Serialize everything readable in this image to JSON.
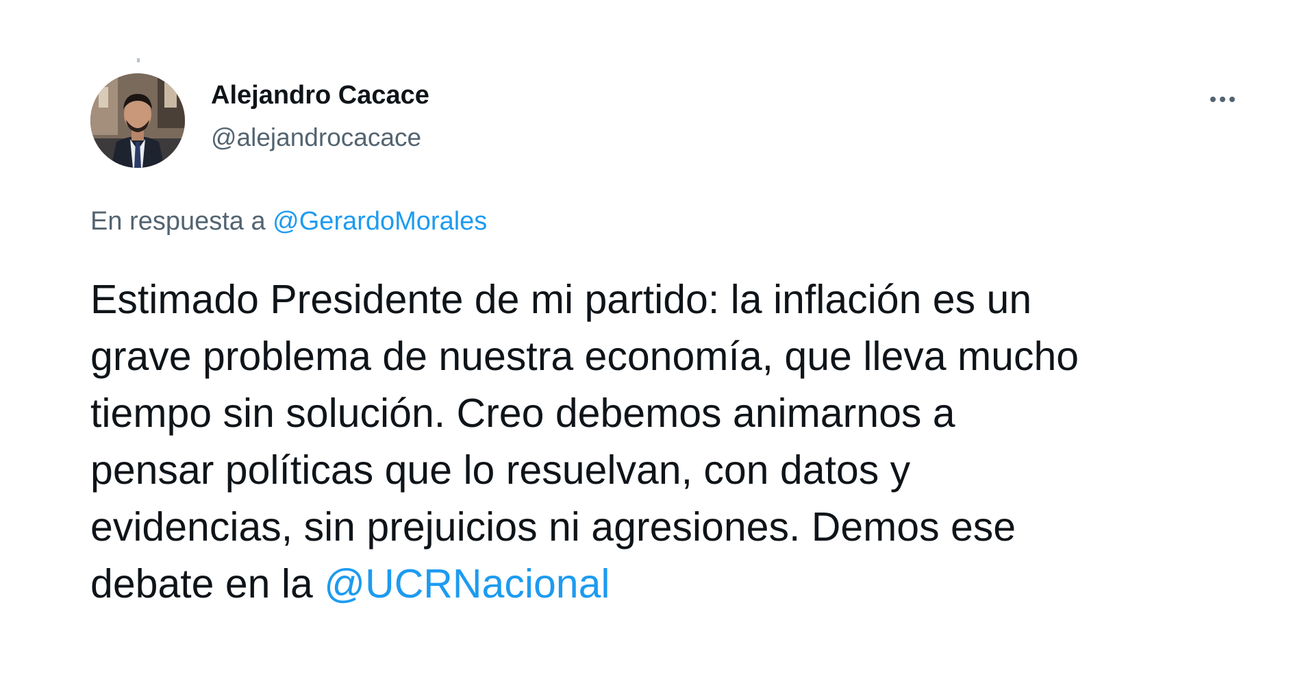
{
  "author": {
    "display_name": "Alejandro Cacace",
    "handle": "@alejandrocacace"
  },
  "menu": {
    "icon": "more-horizontal-icon"
  },
  "reply": {
    "prefix": "En respuesta a",
    "mention": "@GerardoMorales"
  },
  "body": {
    "lines": [
      "Estimado Presidente de mi partido: la inflación es un",
      "grave problema de nuestra economía, que lleva mucho",
      "tiempo sin solución. Creo debemos animarnos a",
      "pensar políticas que lo resuelvan, con datos y",
      "evidencias, sin prejuicios ni agresiones. Demos ese"
    ],
    "last_line_prefix": "debate en la",
    "last_line_mention": "@UCRNacional"
  },
  "colors": {
    "text": "#0f1419",
    "secondary": "#536471",
    "link": "#1d9bf0",
    "background": "#ffffff"
  }
}
